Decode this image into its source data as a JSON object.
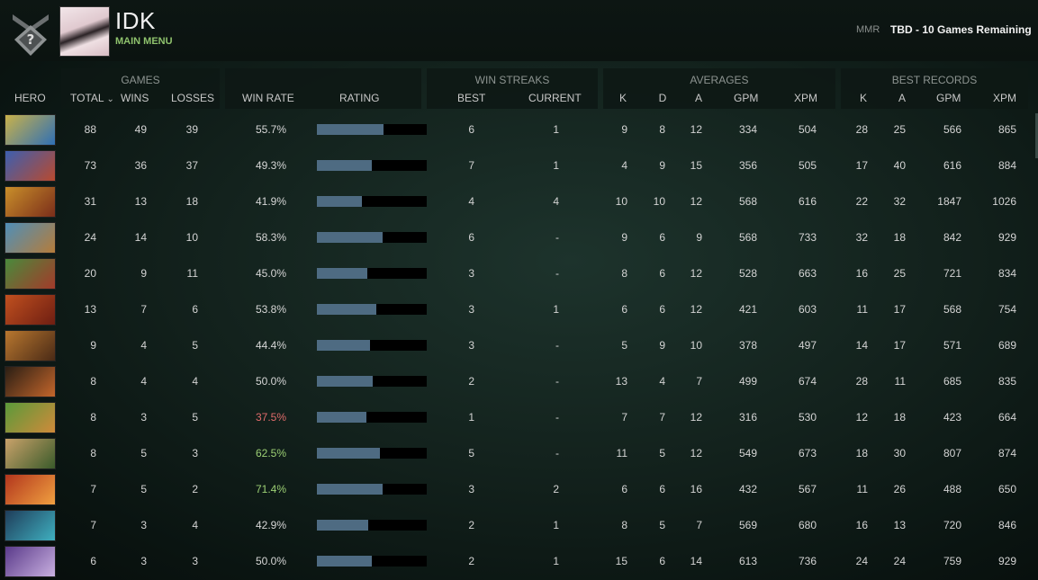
{
  "header": {
    "player_name": "IDK",
    "main_menu_label": "MAIN MENU",
    "mmr_label": "MMR",
    "mmr_value": "TBD - 10 Games Remaining",
    "rank_badge_icon": "uncalibrated-rank-icon"
  },
  "columns": {
    "groups": {
      "games": "GAMES",
      "win_streaks": "WIN STREAKS",
      "averages": "AVERAGES",
      "best_records": "BEST RECORDS"
    },
    "hero": "HERO",
    "total": "TOTAL",
    "sort_indicator": "⌄",
    "wins": "WINS",
    "losses": "LOSSES",
    "win_rate": "WIN RATE",
    "rating": "RATING",
    "best": "BEST",
    "current": "CURRENT",
    "avg_k": "K",
    "avg_d": "D",
    "avg_a": "A",
    "avg_gpm": "GPM",
    "avg_xpm": "XPM",
    "best_k": "K",
    "best_a": "A",
    "best_gpm": "GPM",
    "best_xpm": "XPM"
  },
  "colors": {
    "win_rate_default": "#d6d6d6",
    "win_rate_high": "#9ccf74",
    "win_rate_low": "#e06b6b",
    "rating_bar": "#4e6b82",
    "accent_menu": "#8fc26d"
  },
  "rows": [
    {
      "hero_icon": "hero-portrait-1",
      "total": "88",
      "wins": "49",
      "losses": "39",
      "win_rate": "55.7%",
      "rating": 0.61,
      "best": "6",
      "current": "1",
      "k": "9",
      "d": "8",
      "a": "12",
      "gpm": "334",
      "xpm": "504",
      "bk": "28",
      "ba": "25",
      "bgpm": "566",
      "bxpm": "865",
      "portrait": [
        "#c9b24a",
        "#2f6fb5"
      ]
    },
    {
      "hero_icon": "hero-portrait-2",
      "total": "73",
      "wins": "36",
      "losses": "37",
      "win_rate": "49.3%",
      "rating": 0.5,
      "best": "7",
      "current": "1",
      "k": "4",
      "d": "9",
      "a": "15",
      "gpm": "356",
      "xpm": "505",
      "bk": "17",
      "ba": "40",
      "bgpm": "616",
      "bxpm": "884",
      "portrait": [
        "#3d5fb0",
        "#b84a2f"
      ]
    },
    {
      "hero_icon": "hero-portrait-3",
      "total": "31",
      "wins": "13",
      "losses": "18",
      "win_rate": "41.9%",
      "rating": 0.41,
      "best": "4",
      "current": "4",
      "k": "10",
      "d": "10",
      "a": "12",
      "gpm": "568",
      "xpm": "616",
      "bk": "22",
      "ba": "32",
      "bgpm": "1847",
      "bxpm": "1026",
      "portrait": [
        "#c98f2a",
        "#7a2d1a"
      ]
    },
    {
      "hero_icon": "hero-portrait-4",
      "total": "24",
      "wins": "14",
      "losses": "10",
      "win_rate": "58.3%",
      "rating": 0.6,
      "best": "6",
      "current": "-",
      "k": "9",
      "d": "6",
      "a": "9",
      "gpm": "568",
      "xpm": "733",
      "bk": "32",
      "ba": "18",
      "bgpm": "842",
      "bxpm": "929",
      "portrait": [
        "#4f8fb8",
        "#b57c3a"
      ]
    },
    {
      "hero_icon": "hero-portrait-5",
      "total": "20",
      "wins": "9",
      "losses": "11",
      "win_rate": "45.0%",
      "rating": 0.46,
      "best": "3",
      "current": "-",
      "k": "8",
      "d": "6",
      "a": "12",
      "gpm": "528",
      "xpm": "663",
      "bk": "16",
      "ba": "25",
      "bgpm": "721",
      "bxpm": "834",
      "portrait": [
        "#4a8a3c",
        "#a33a2a"
      ]
    },
    {
      "hero_icon": "hero-portrait-6",
      "total": "13",
      "wins": "7",
      "losses": "6",
      "win_rate": "53.8%",
      "rating": 0.54,
      "best": "3",
      "current": "1",
      "k": "6",
      "d": "6",
      "a": "12",
      "gpm": "421",
      "xpm": "603",
      "bk": "11",
      "ba": "17",
      "bgpm": "568",
      "bxpm": "754",
      "portrait": [
        "#c0501f",
        "#6e1e12"
      ]
    },
    {
      "hero_icon": "hero-portrait-7",
      "total": "9",
      "wins": "4",
      "losses": "5",
      "win_rate": "44.4%",
      "rating": 0.48,
      "best": "3",
      "current": "-",
      "k": "5",
      "d": "9",
      "a": "10",
      "gpm": "378",
      "xpm": "497",
      "bk": "14",
      "ba": "17",
      "bgpm": "571",
      "bxpm": "689",
      "portrait": [
        "#b8772f",
        "#4a2a16"
      ]
    },
    {
      "hero_icon": "hero-portrait-8",
      "total": "8",
      "wins": "4",
      "losses": "4",
      "win_rate": "50.0%",
      "rating": 0.51,
      "best": "2",
      "current": "-",
      "k": "13",
      "d": "4",
      "a": "7",
      "gpm": "499",
      "xpm": "674",
      "bk": "28",
      "ba": "11",
      "bgpm": "685",
      "bxpm": "835",
      "portrait": [
        "#2a1e14",
        "#c4662b"
      ]
    },
    {
      "hero_icon": "hero-portrait-9",
      "total": "8",
      "wins": "3",
      "losses": "5",
      "win_rate": "37.5%",
      "rating": 0.45,
      "best": "1",
      "current": "-",
      "k": "7",
      "d": "7",
      "a": "12",
      "gpm": "316",
      "xpm": "530",
      "bk": "12",
      "ba": "18",
      "bgpm": "423",
      "bxpm": "664",
      "portrait": [
        "#5a9a3a",
        "#d08a3a"
      ]
    },
    {
      "hero_icon": "hero-portrait-10",
      "total": "8",
      "wins": "5",
      "losses": "3",
      "win_rate": "62.5%",
      "rating": 0.57,
      "best": "5",
      "current": "-",
      "k": "11",
      "d": "5",
      "a": "12",
      "gpm": "549",
      "xpm": "673",
      "bk": "18",
      "ba": "30",
      "bgpm": "807",
      "bxpm": "874",
      "portrait": [
        "#c9a26a",
        "#3a5a2a"
      ]
    },
    {
      "hero_icon": "hero-portrait-11",
      "total": "7",
      "wins": "5",
      "losses": "2",
      "win_rate": "71.4%",
      "rating": 0.6,
      "best": "3",
      "current": "2",
      "k": "6",
      "d": "6",
      "a": "16",
      "gpm": "432",
      "xpm": "567",
      "bk": "11",
      "ba": "26",
      "bgpm": "488",
      "bxpm": "650",
      "portrait": [
        "#b2361d",
        "#f0a040"
      ]
    },
    {
      "hero_icon": "hero-portrait-12",
      "total": "7",
      "wins": "3",
      "losses": "4",
      "win_rate": "42.9%",
      "rating": 0.47,
      "best": "2",
      "current": "1",
      "k": "8",
      "d": "5",
      "a": "7",
      "gpm": "569",
      "xpm": "680",
      "bk": "16",
      "ba": "13",
      "bgpm": "720",
      "bxpm": "846",
      "portrait": [
        "#1f3d5a",
        "#3fb0c0"
      ]
    },
    {
      "hero_icon": "hero-portrait-13",
      "total": "6",
      "wins": "3",
      "losses": "3",
      "win_rate": "50.0%",
      "rating": 0.5,
      "best": "2",
      "current": "1",
      "k": "15",
      "d": "6",
      "a": "14",
      "gpm": "613",
      "xpm": "736",
      "bk": "24",
      "ba": "24",
      "bgpm": "759",
      "bxpm": "929",
      "portrait": [
        "#5a3a8a",
        "#c9b0e0"
      ]
    }
  ]
}
